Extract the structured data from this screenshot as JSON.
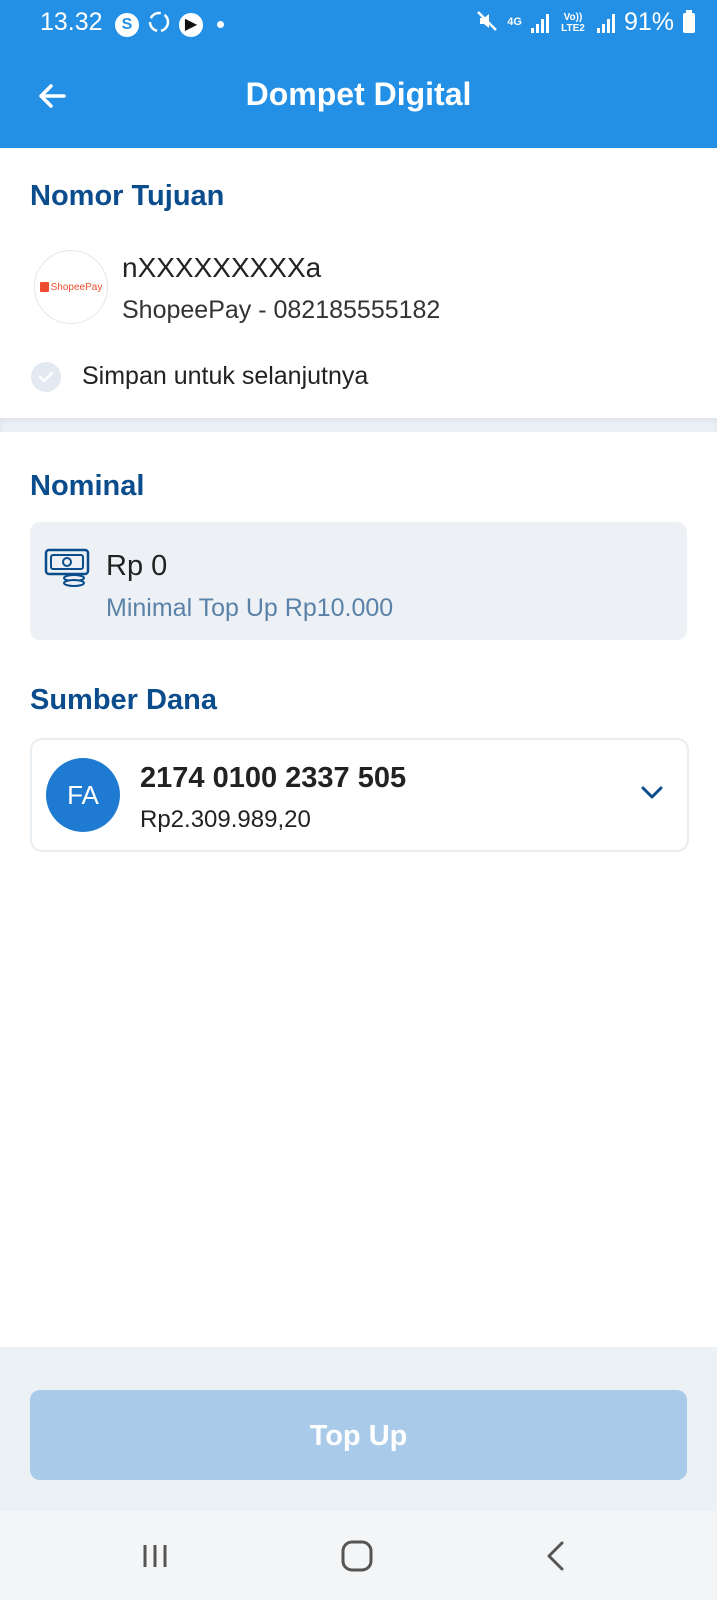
{
  "status_bar": {
    "time": "13.32",
    "network_4g": "4G",
    "network_volte": "Vo)) LTE2",
    "battery": "91%"
  },
  "header": {
    "title": "Dompet Digital",
    "back_icon": "arrow-left-icon"
  },
  "destination": {
    "section_title": "Nomor Tujuan",
    "logo_label": "ShopeePay",
    "name": "nXXXXXXXXXa",
    "detail": "ShopeePay - 082185555182",
    "save_label": "Simpan untuk selanjutnya"
  },
  "nominal": {
    "section_title": "Nominal",
    "value": "Rp 0",
    "hint": "Minimal Top Up Rp10.000",
    "icon": "money-icon"
  },
  "source": {
    "section_title": "Sumber Dana",
    "avatar_initials": "FA",
    "account_number": "2174 0100 2337 505",
    "balance": "Rp2.309.989,20",
    "icon": "chevron-down-icon"
  },
  "action": {
    "topup_label": "Top Up"
  },
  "colors": {
    "primary": "#2490e5",
    "heading": "#0b4d8c",
    "button_disabled": "#a9cbe9",
    "avatar": "#1f7bd2",
    "hint": "#5a82a8"
  }
}
